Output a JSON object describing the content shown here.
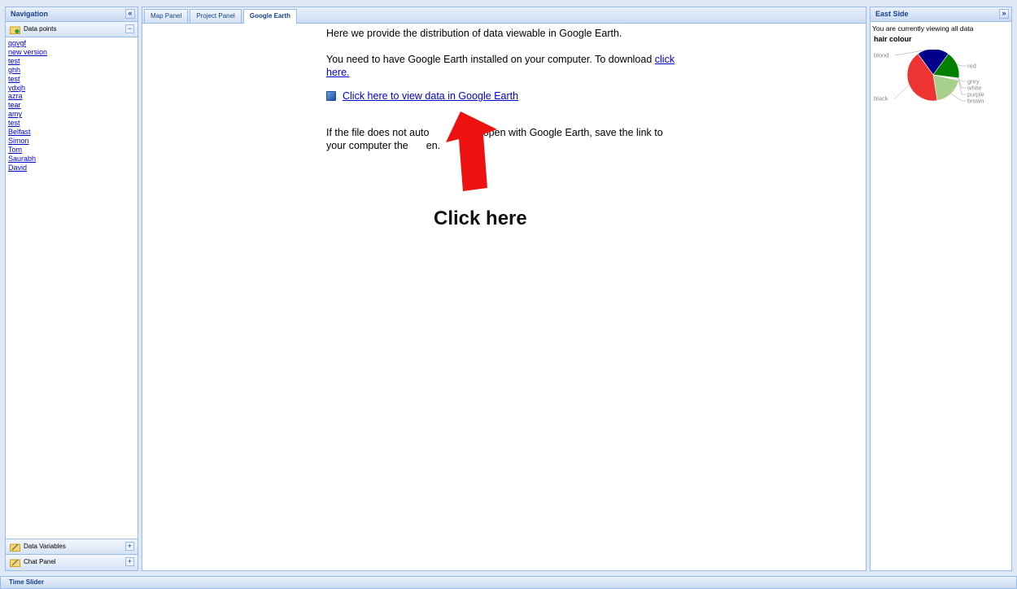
{
  "west": {
    "title": "Navigation",
    "collapse_glyph": "«",
    "data_points_header": "Data points",
    "data_points": [
      "qqvgf",
      "new version",
      "test",
      "ghh",
      "test",
      "ydxjh",
      "azra",
      "tear",
      "amy",
      "test",
      "Belfast",
      "Simon",
      "Tom",
      "Saurabh",
      "David"
    ],
    "data_variables_header": "Data Variables",
    "chat_panel_header": "Chat Panel",
    "minus_glyph": "−",
    "plus_glyph": "+"
  },
  "center": {
    "tabs": [
      {
        "label": "Map Panel",
        "active": false
      },
      {
        "label": "Project Panel",
        "active": false
      },
      {
        "label": "Google Earth",
        "active": true
      }
    ],
    "intro": "Here we provide the distribution of data viewable in Google Earth.",
    "install_text": "You need to have Google Earth installed on your computer. To download",
    "install_link": "click here.",
    "ge_link": "Click here to view data in Google Earth",
    "note_before": "If the file does not auto",
    "note_after": "ally open with Google Earth, save the link to your computer the",
    "note_end": "en.",
    "annotation": "Click here"
  },
  "east": {
    "title": "East Side",
    "expand_glyph": "»",
    "note": "You are currently viewing all data",
    "chart_title": "hair colour"
  },
  "chart_data": {
    "type": "pie",
    "title": "hair colour",
    "labels": [
      "blond",
      "red",
      "grey",
      "white",
      "purple",
      "brown",
      "black"
    ],
    "values": [
      20,
      17,
      0.5,
      0.5,
      0.5,
      19,
      42.5
    ],
    "colors": [
      "#00008b",
      "#008000",
      "#a0a0a0",
      "#e8e8e8",
      "#b070c0",
      "#a8d08d",
      "#ee3333"
    ]
  },
  "bottom": {
    "title": "Time Slider"
  },
  "colors": {
    "header_text": "#15428b",
    "border": "#99bbe8",
    "link": "#0000cc",
    "arrow": "#ee1111"
  }
}
